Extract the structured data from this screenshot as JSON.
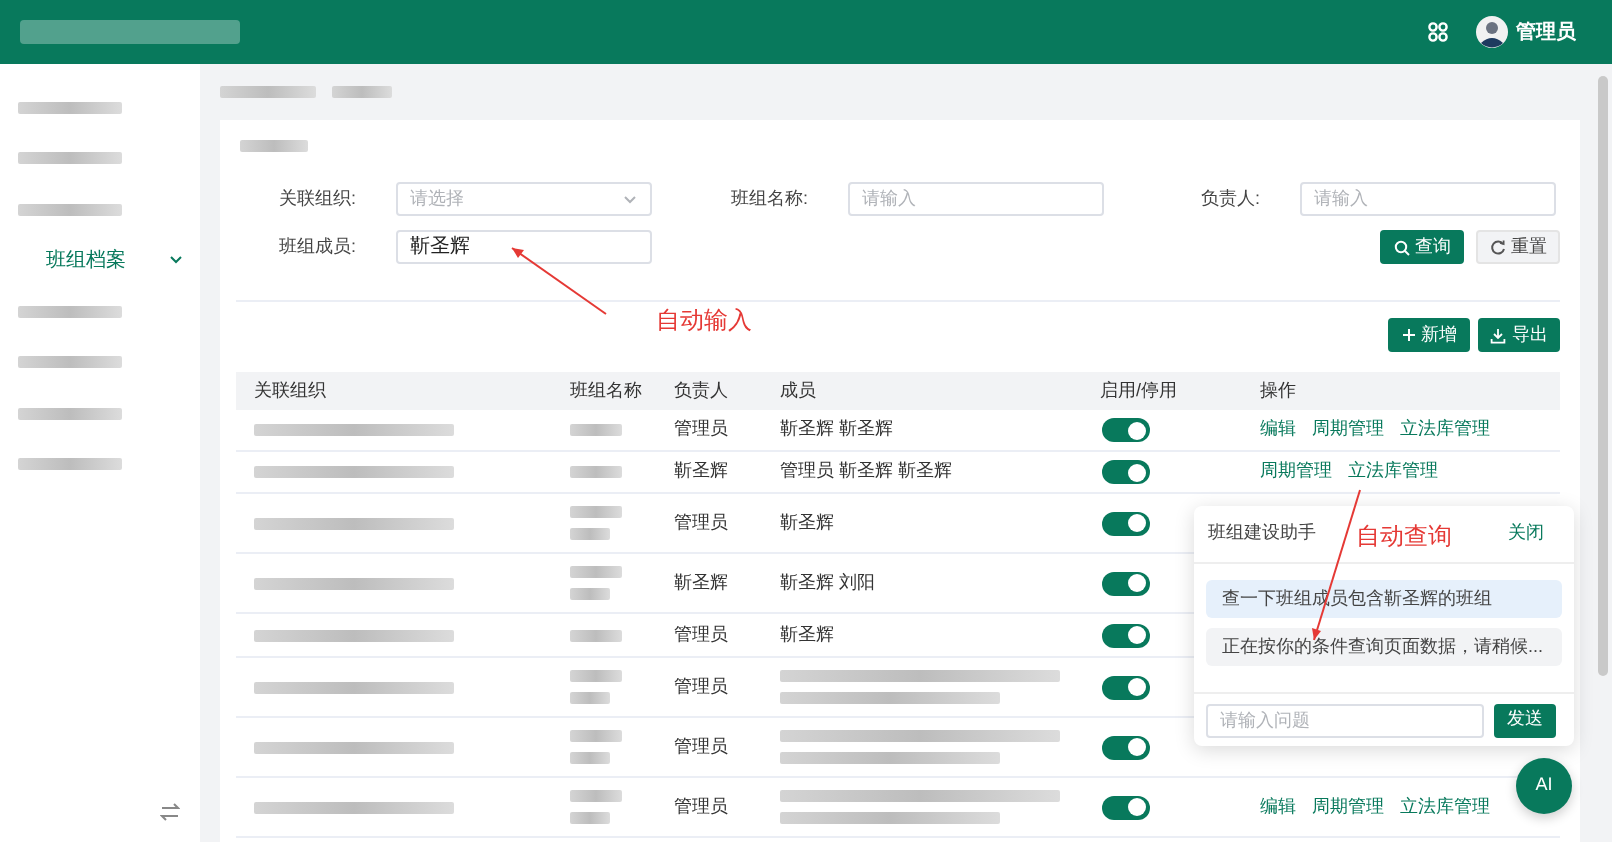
{
  "header": {
    "user": "管理员"
  },
  "sidebar": {
    "items": [
      {
        "kind": "redacted"
      },
      {
        "kind": "redacted"
      },
      {
        "kind": "redacted"
      },
      {
        "kind": "menu",
        "label": "班组档案",
        "expanded": true,
        "selected": true
      },
      {
        "kind": "redacted"
      },
      {
        "kind": "redacted"
      },
      {
        "kind": "redacted"
      },
      {
        "kind": "redacted"
      }
    ]
  },
  "filters": [
    {
      "kind": "select",
      "label": "关联组织:",
      "placeholder": "请选择"
    },
    {
      "kind": "input",
      "label": "班组名称:",
      "placeholder": "请输入"
    },
    {
      "kind": "input",
      "label": "负责人:",
      "placeholder": "请输入"
    },
    {
      "kind": "input",
      "label": "班组成员:",
      "value": "靳圣辉"
    }
  ],
  "search_button": "查询",
  "reset_button": "重置",
  "toolbar": [
    {
      "kind": "add",
      "label": "新增"
    },
    {
      "kind": "export",
      "label": "导出"
    }
  ],
  "table": {
    "columns": [
      "关联组织",
      "班组名称",
      "负责人",
      "成员",
      "启用/停用",
      "操作"
    ],
    "rows": [
      {
        "org_blurred": true,
        "team_blurred": true,
        "leader": "管理员",
        "members": "靳圣辉 靳圣辉",
        "enabled": true,
        "actions": [
          "编辑",
          "周期管理",
          "立法库管理"
        ]
      },
      {
        "org_blurred": true,
        "team_blurred": true,
        "leader": "靳圣辉",
        "members": "管理员 靳圣辉 靳圣辉",
        "enabled": true,
        "actions": [
          "周期管理",
          "立法库管理"
        ]
      },
      {
        "org_blurred": true,
        "team_blurred": true,
        "wrapped": true,
        "leader": "管理员",
        "members": "靳圣辉",
        "enabled": true
      },
      {
        "org_blurred": true,
        "team_blurred": true,
        "wrapped": true,
        "leader": "靳圣辉",
        "members": "靳圣辉 刘阳",
        "enabled": true
      },
      {
        "org_blurred": true,
        "team_blurred": true,
        "leader": "管理员",
        "members": "靳圣辉",
        "enabled": true
      },
      {
        "org_blurred": true,
        "team_blurred": true,
        "members_blurred": true,
        "wrapped": true,
        "leader": "管理员",
        "enabled": true
      },
      {
        "org_blurred": true,
        "team_blurred": true,
        "members_blurred": true,
        "wrapped": true,
        "leader": "管理员",
        "enabled": true
      },
      {
        "org_blurred": true,
        "team_blurred": true,
        "members_blurred": true,
        "wrapped": true,
        "leader": "管理员",
        "enabled": true,
        "actions": [
          "编辑",
          "周期管理",
          "立法库管理"
        ]
      }
    ]
  },
  "annotations": [
    {
      "text": "自动输入"
    },
    {
      "text": "自动查询"
    }
  ],
  "assistant": {
    "title": "班组建设助手",
    "close": "关闭",
    "messages": [
      {
        "kind": "user",
        "text": "查一下班组成员包含靳圣辉的班组"
      },
      {
        "kind": "assistant",
        "text": "正在按你的条件查询页面数据，请稍候..."
      }
    ],
    "placeholder": "请输入问题",
    "send": "发送"
  },
  "fab": "AI"
}
